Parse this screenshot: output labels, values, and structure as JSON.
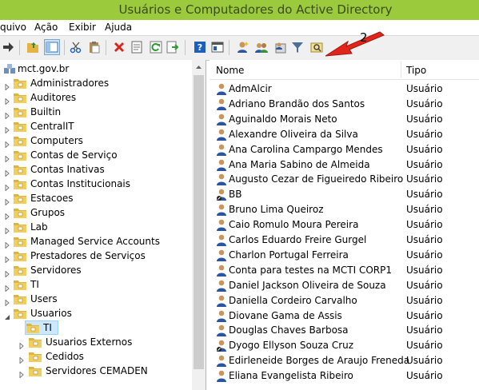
{
  "window": {
    "title": "Usuários e Computadores do Active Directory"
  },
  "menu": [
    "quivo",
    "Ação",
    "Exibir",
    "Ajuda"
  ],
  "toolbar": {
    "buttons": [
      "forward-icon",
      "folder-up-icon",
      "show-hide-tree-icon",
      "cut-icon",
      "paste-icon",
      "delete-icon",
      "properties-icon",
      "refresh-icon",
      "export-icon",
      "help-icon",
      "console-icon",
      "new-user-icon",
      "new-group-icon",
      "add-to-group-icon",
      "filter-icon",
      "find-icon"
    ]
  },
  "annotation": {
    "number": "2",
    "color": "#e0261b"
  },
  "tree": {
    "root": "mct.gov.br",
    "items": [
      "Administradores",
      "Auditores",
      "Builtin",
      "CentralIT",
      "Computers",
      "Contas de Serviço",
      "Contas Inativas",
      "Contas Institucionais",
      "Estacoes",
      "Grupos",
      "Lab",
      "Managed Service Accounts",
      "Prestadores de Serviços",
      "Servidores",
      "TI",
      "Users",
      "Usuarios"
    ],
    "children": [
      "TI",
      "Usuarios Externos",
      "Cedidos",
      "Servidores CEMADEN"
    ],
    "selected": "TI"
  },
  "list": {
    "columns": {
      "name": "Nome",
      "type": "Tipo"
    },
    "rows": [
      {
        "name": "AdmAlcir",
        "type": "Usuário"
      },
      {
        "name": "Adriano Brandão dos Santos",
        "type": "Usuário"
      },
      {
        "name": "Aguinaldo Morais Neto",
        "type": "Usuário"
      },
      {
        "name": "Alexandre Oliveira da Silva",
        "type": "Usuário"
      },
      {
        "name": "Ana Carolina Campargo Mendes",
        "type": "Usuário"
      },
      {
        "name": "Ana Maria Sabino de Almeida",
        "type": "Usuário"
      },
      {
        "name": "Augusto Cezar de Figueiredo Ribeiro",
        "type": "Usuário"
      },
      {
        "name": "BB",
        "type": "Usuário"
      },
      {
        "name": "Bruno Lima Queiroz",
        "type": "Usuário"
      },
      {
        "name": "Caio Romulo Moura Pereira",
        "type": "Usuário"
      },
      {
        "name": "Carlos Eduardo Freire Gurgel",
        "type": "Usuário"
      },
      {
        "name": "Charlon Portugal Ferreira",
        "type": "Usuário"
      },
      {
        "name": "Conta para testes na MCTI CORP1",
        "type": "Usuário"
      },
      {
        "name": "Daniel Jackson Oliveira de Souza",
        "type": "Usuário"
      },
      {
        "name": "Daniella Cordeiro Carvalho",
        "type": "Usuário"
      },
      {
        "name": "Diovane Gama de Assis",
        "type": "Usuário"
      },
      {
        "name": "Douglas Chaves Barbosa",
        "type": "Usuário"
      },
      {
        "name": "Dyogo Ellyson Souza Cruz",
        "type": "Usuário"
      },
      {
        "name": "Edirleneide Borges de Araujo Freneda",
        "type": "Usuário"
      },
      {
        "name": "Eliana Evangelista Ribeiro",
        "type": "Usuário"
      }
    ]
  }
}
